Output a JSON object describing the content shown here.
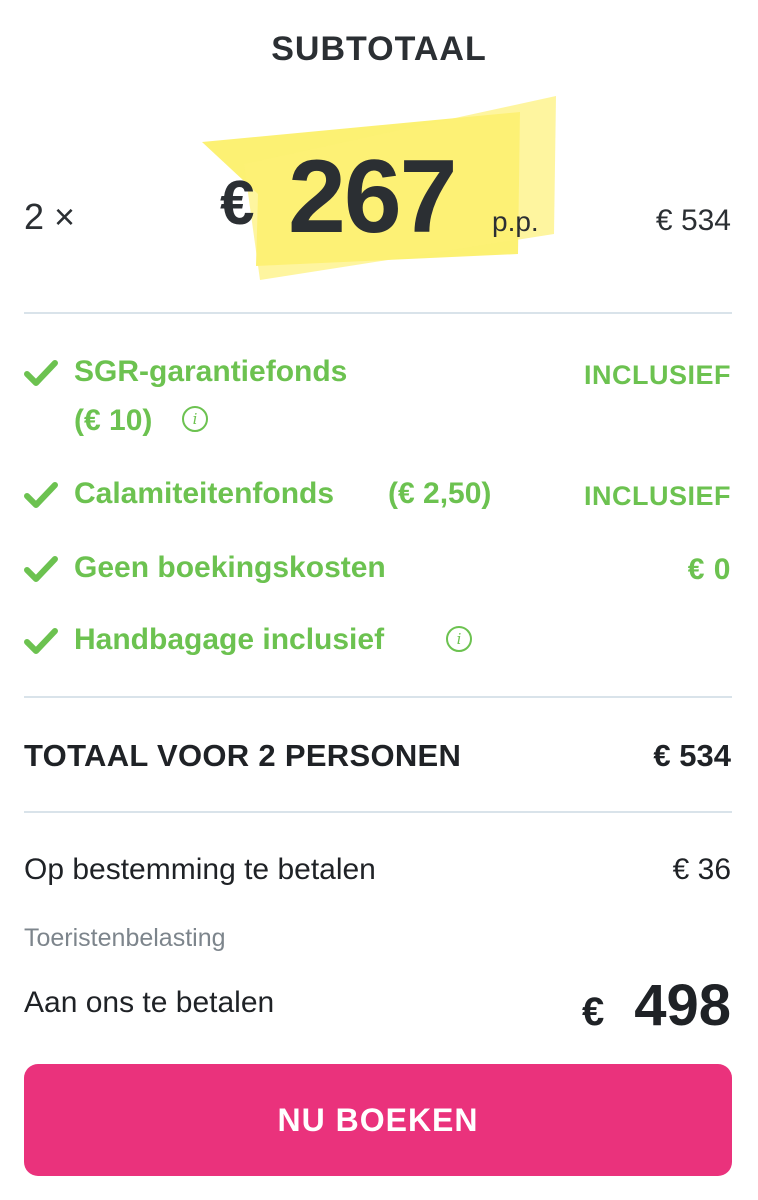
{
  "subtotal": {
    "title": "SUBTOTAAL",
    "quantity": "2 ×",
    "price_currency": "€",
    "price_value": "267",
    "per_person": "p.p.",
    "amount": "€ 534",
    "highlight_color": "#f8e74c"
  },
  "features": [
    {
      "label_line1": "SGR-garantiefonds",
      "label_line2": "(€ 10)",
      "value": "INCLUSIEF",
      "has_info": true,
      "icon": "check-icon"
    },
    {
      "label": "Calamiteitenfonds",
      "label_extra": "(€ 2,50)",
      "value": "INCLUSIEF",
      "icon": "check-icon"
    },
    {
      "label": "Geen boekingskosten",
      "value": "€ 0",
      "icon": "check-icon"
    },
    {
      "label": "Handbagage inclusief",
      "has_info": true,
      "icon": "check-icon"
    }
  ],
  "total": {
    "label": "TOTAAL VOOR 2 PERSONEN",
    "value": "€ 534"
  },
  "destination": {
    "label": "Op bestemming te betalen",
    "value": "€ 36",
    "note": "Toeristenbelasting"
  },
  "pay": {
    "label": "Aan ons te betalen",
    "currency": "€",
    "value": "498"
  },
  "button": {
    "label": "NU BOEKEN",
    "color": "#ea327c"
  },
  "colors": {
    "green": "#6cc250",
    "text": "#1f2226",
    "divider": "#d9e3ea"
  }
}
